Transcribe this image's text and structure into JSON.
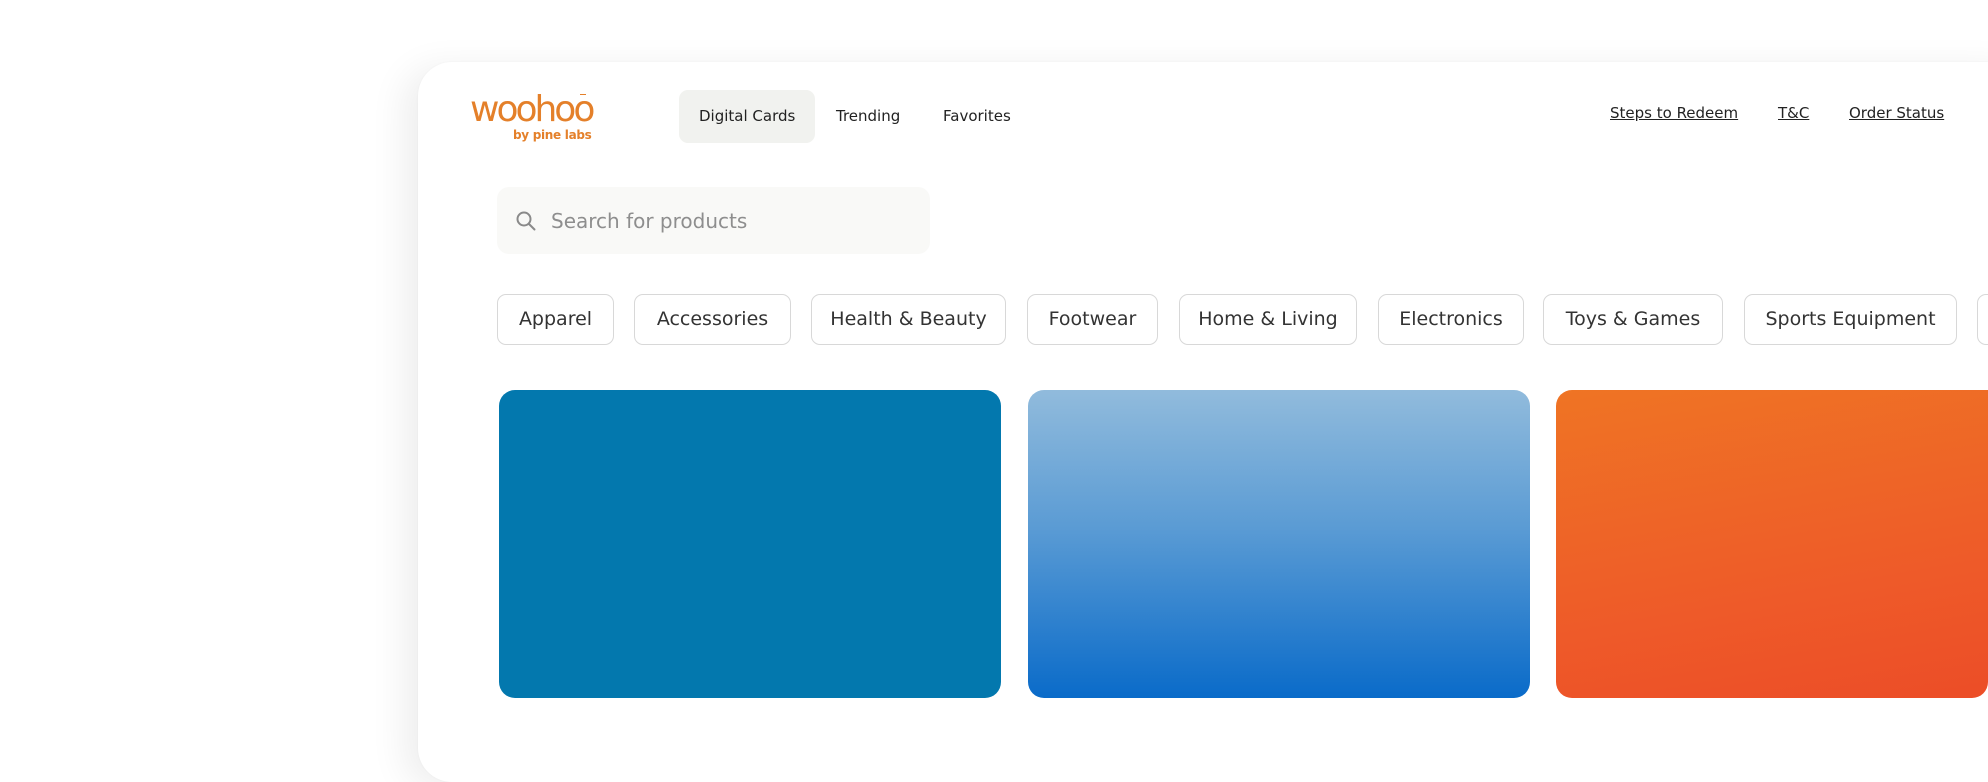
{
  "brand": {
    "name": "woohoo",
    "sub": "by pine labs",
    "color": "#e4802a"
  },
  "nav": {
    "tabs": [
      {
        "label": "Digital Cards",
        "active": true
      },
      {
        "label": "Trending",
        "active": false
      },
      {
        "label": "Favorites",
        "active": false
      }
    ],
    "links": [
      {
        "label": "Steps to Redeem"
      },
      {
        "label": "T&C"
      },
      {
        "label": "Order Status"
      }
    ]
  },
  "search": {
    "placeholder": "Search for products",
    "icon": "search-icon"
  },
  "categories": [
    "Apparel",
    "Accessories",
    "Health & Beauty",
    "Footwear",
    "Home & Living",
    "Electronics",
    "Toys & Games",
    "Sports Equipment"
  ],
  "cards": [
    {
      "color": "#0378ae"
    },
    {
      "color_top": "#91bbdc",
      "color_bottom": "#0a6bc9"
    },
    {
      "color_top": "#ef7424",
      "color_bottom": "#ec4d27"
    }
  ]
}
